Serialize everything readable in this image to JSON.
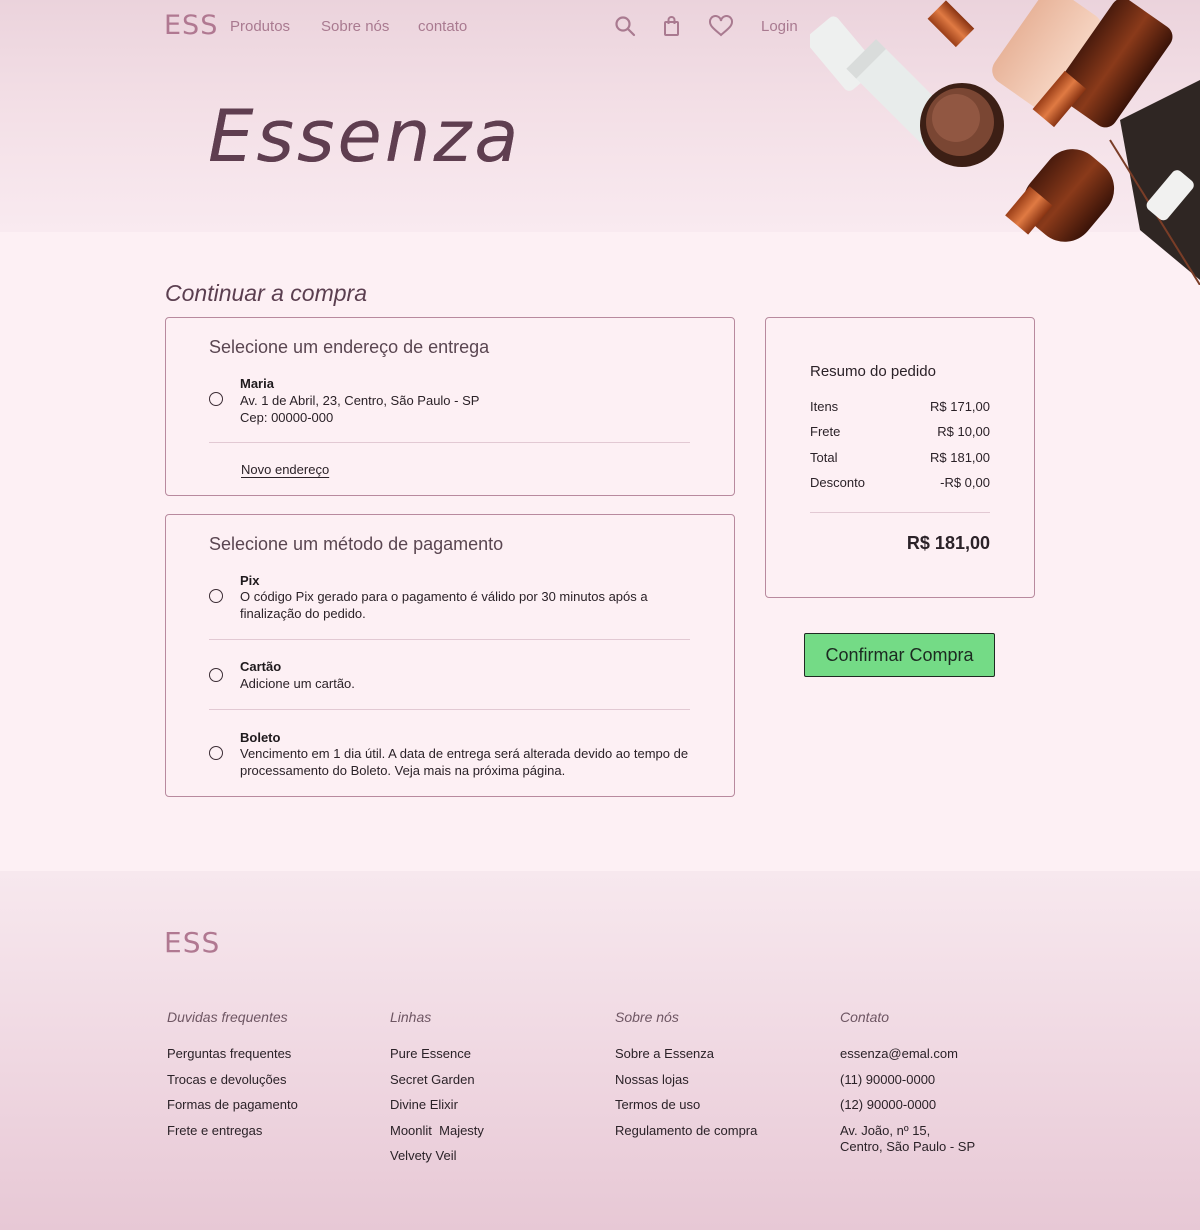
{
  "header": {
    "logo": "ESS",
    "nav": [
      "Produtos",
      "Sobre nós",
      "contato"
    ],
    "icons": [
      "search-icon",
      "shopping-bag-icon",
      "heart-icon"
    ],
    "login": "Login",
    "brand_title": "Essenza"
  },
  "main": {
    "title": "Continuar a compra",
    "address": {
      "heading": "Selecione um endereço de entrega",
      "option": {
        "name": "Maria",
        "line1": "Av. 1 de Abril, 23, Centro, São Paulo - SP",
        "line2": "Cep: 00000-000"
      },
      "new_address": "Novo endereço"
    },
    "payment": {
      "heading": "Selecione um método de pagamento",
      "options": [
        {
          "title": "Pix",
          "text": "O código Pix gerado para o pagamento é válido por 30 minutos após a finalização do pedido."
        },
        {
          "title": "Cartão",
          "text": "Adicione um cartão."
        },
        {
          "title": "Boleto",
          "text": "Vencimento em 1 dia útil. A data de entrega será alterada devido ao tempo de processamento do Boleto. Veja mais na próxima página."
        }
      ]
    },
    "summary": {
      "heading": "Resumo do pedido",
      "rows": [
        {
          "label": "Itens",
          "value": "R$ 171,00"
        },
        {
          "label": "Frete",
          "value": "R$ 10,00"
        },
        {
          "label": "Total",
          "value": "R$ 181,00"
        },
        {
          "label": "Desconto",
          "value": "-R$ 0,00"
        }
      ],
      "grand_total": "R$ 181,00"
    },
    "confirm_button": "Confirmar Compra"
  },
  "footer": {
    "logo": "ESS",
    "columns": [
      {
        "heading": "Duvidas frequentes",
        "items": [
          "Perguntas frequentes",
          "Trocas e devoluções",
          "Formas de pagamento",
          "Frete e entregas"
        ]
      },
      {
        "heading": "Linhas",
        "items": [
          "Pure Essence",
          "Secret Garden",
          "Divine Elixir",
          "Moonlit  Majesty",
          "Velvety Veil"
        ]
      },
      {
        "heading": "Sobre nós",
        "items": [
          "Sobre a Essenza",
          "Nossas lojas",
          "Termos de uso",
          "Regulamento de compra"
        ]
      },
      {
        "heading": "Contato",
        "items": [
          "essenza@emal.com",
          "(11) 90000-0000",
          "(12) 90000-0000",
          "Av. João, nº 15,\nCentro, São Paulo - SP"
        ]
      }
    ]
  },
  "colors": {
    "accent": "#b07891",
    "button": "#74db86",
    "border": "#b88a9e",
    "background": "#fdf0f4"
  }
}
